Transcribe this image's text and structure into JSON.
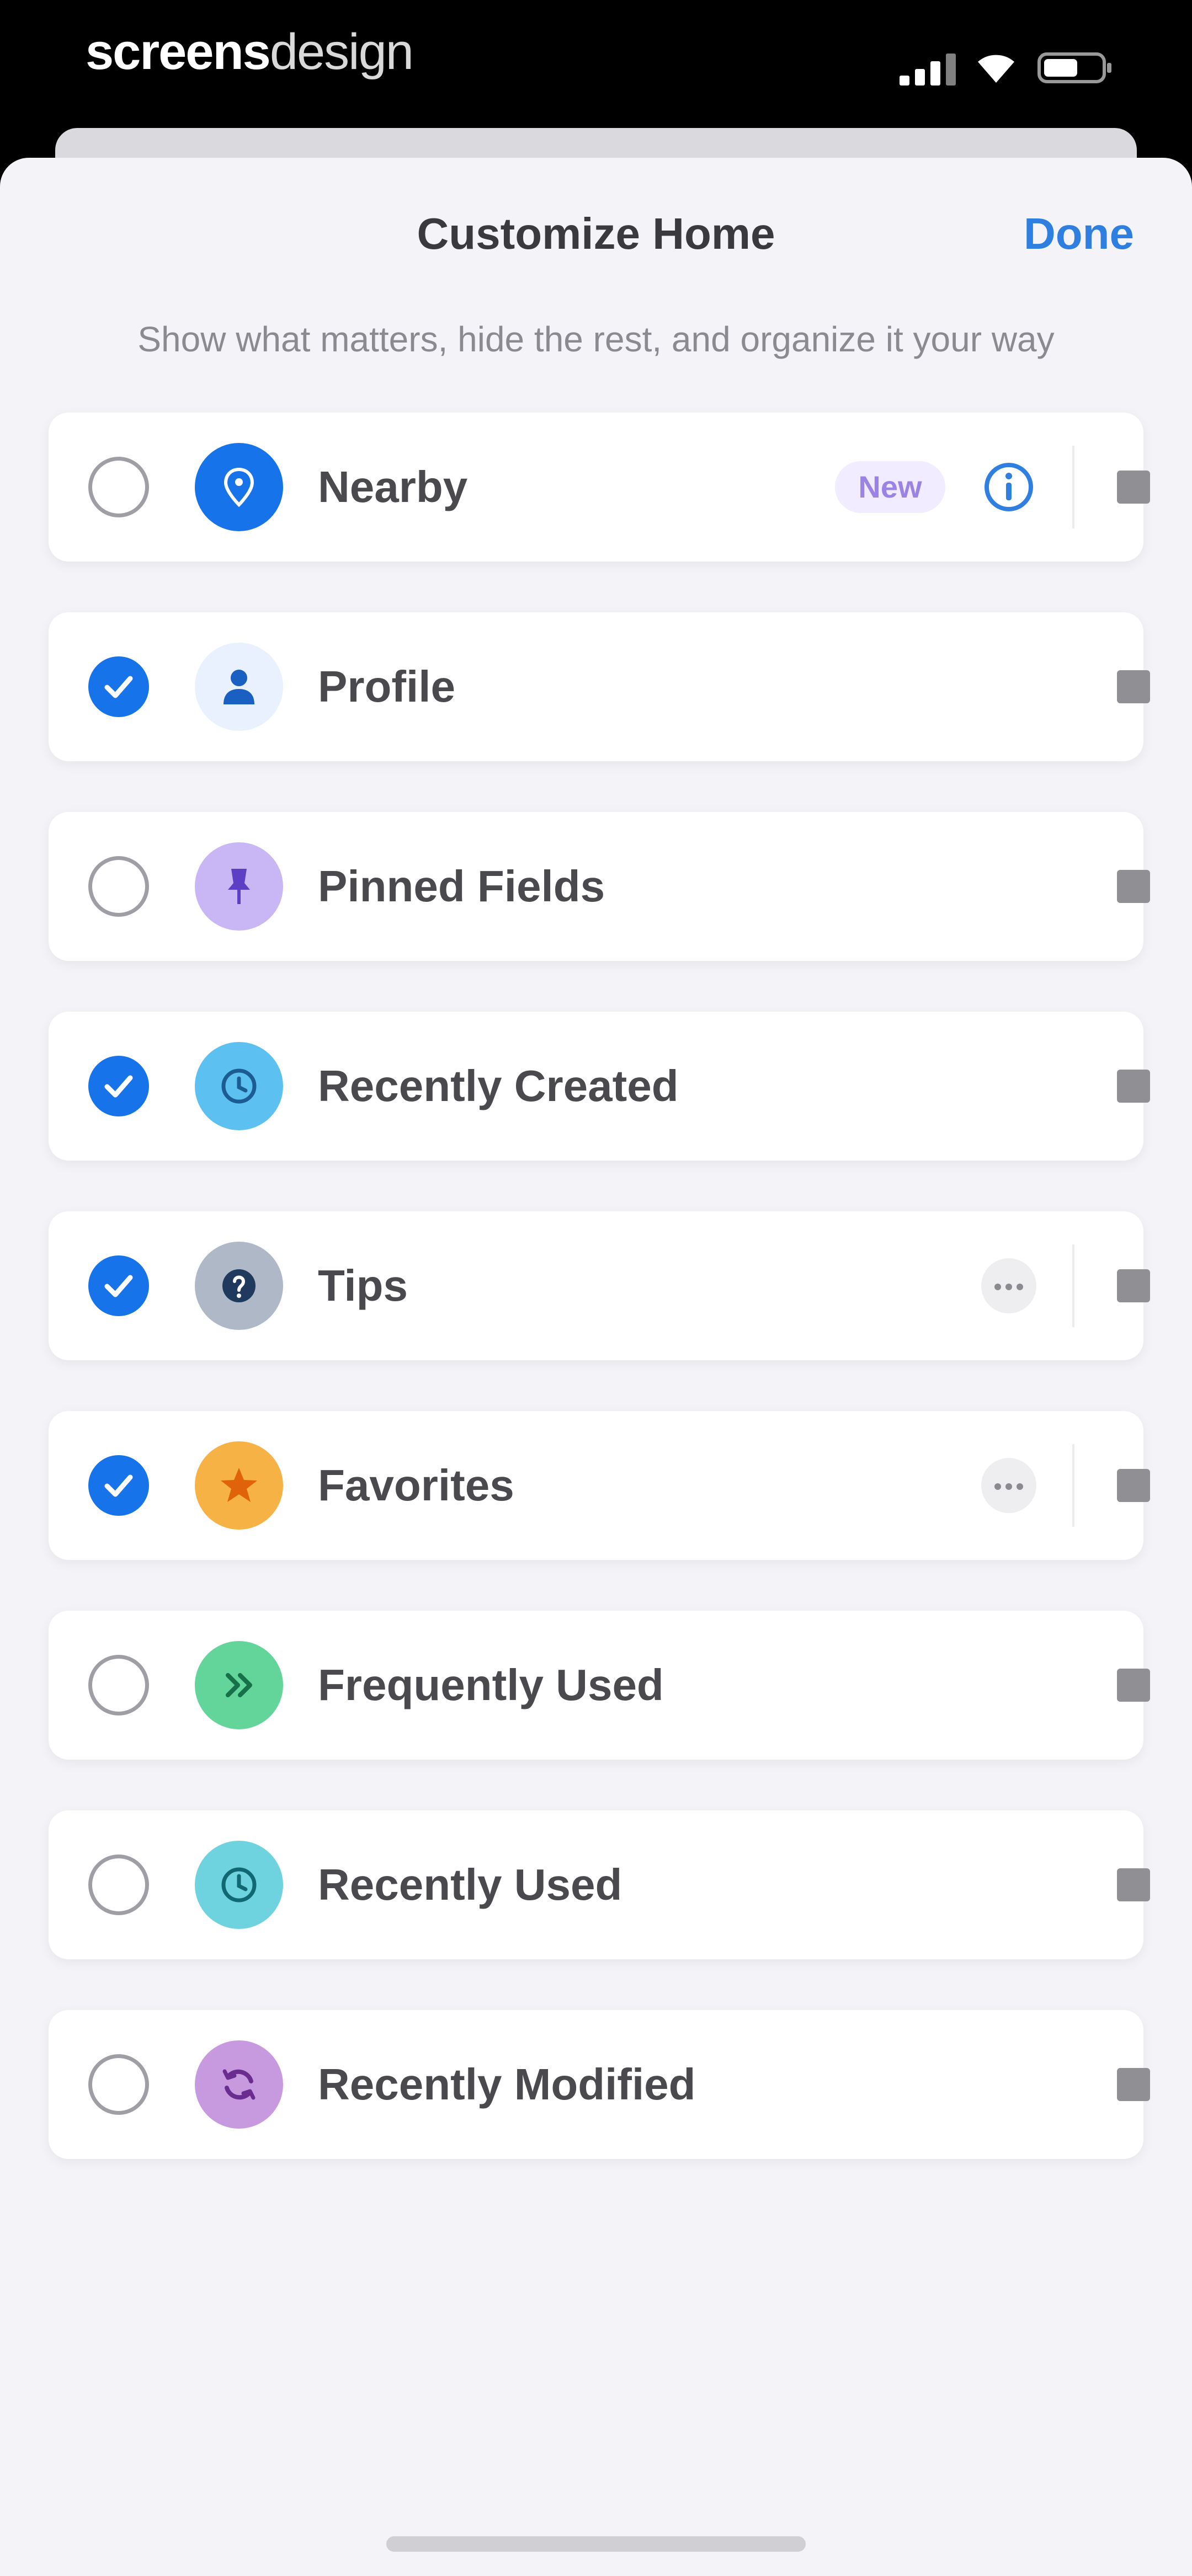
{
  "status_bar": {
    "brand_part1": "screens",
    "brand_part2": "design"
  },
  "sheet": {
    "title": "Customize Home",
    "done_label": "Done",
    "subtitle": "Show what matters, hide the rest, and organize it your way"
  },
  "items": [
    {
      "label": "Nearby",
      "checked": false,
      "icon": "location-pin-icon",
      "badge": "New",
      "action": "info"
    },
    {
      "label": "Profile",
      "checked": true,
      "icon": "person-icon",
      "badge": "",
      "action": ""
    },
    {
      "label": "Pinned Fields",
      "checked": false,
      "icon": "pushpin-icon",
      "badge": "",
      "action": ""
    },
    {
      "label": "Recently Created",
      "checked": true,
      "icon": "clock-plus-icon",
      "badge": "",
      "action": ""
    },
    {
      "label": "Tips",
      "checked": true,
      "icon": "question-mark-icon",
      "badge": "",
      "action": "more"
    },
    {
      "label": "Favorites",
      "checked": true,
      "icon": "star-icon",
      "badge": "",
      "action": "more"
    },
    {
      "label": "Frequently Used",
      "checked": false,
      "icon": "double-chevron-icon",
      "badge": "",
      "action": ""
    },
    {
      "label": "Recently Used",
      "checked": false,
      "icon": "clock-icon",
      "badge": "",
      "action": ""
    },
    {
      "label": "Recently Modified",
      "checked": false,
      "icon": "refresh-icon",
      "badge": "",
      "action": ""
    }
  ],
  "colors": {
    "accent": "#1673ea",
    "done_blue": "#2f7fe0",
    "sheet_background": "#f4f3f8",
    "icon_backgrounds": [
      "#1673ea",
      "#e8f1fd",
      "#c9b6f5",
      "#5cc0f0",
      "#aeb8c6",
      "#f7b246",
      "#63d49a",
      "#6fd3df",
      "#c79ae0"
    ]
  }
}
